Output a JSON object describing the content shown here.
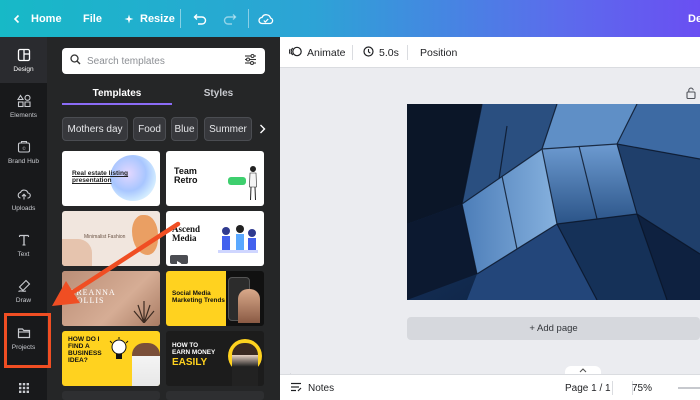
{
  "topbar": {
    "home_label": "Home",
    "file_label": "File",
    "resize_label": "Resize",
    "right_truncated_text": "De"
  },
  "rail": {
    "items": [
      {
        "label": "Design",
        "icon": "layout-icon",
        "active": true
      },
      {
        "label": "Elements",
        "icon": "shapes-icon",
        "active": false
      },
      {
        "label": "Brand Hub",
        "icon": "brand-icon",
        "active": false
      },
      {
        "label": "Uploads",
        "icon": "cloud-upload-icon",
        "active": false
      },
      {
        "label": "Text",
        "icon": "text-icon",
        "active": false
      },
      {
        "label": "Draw",
        "icon": "draw-icon",
        "active": false
      },
      {
        "label": "Projects",
        "icon": "folder-icon",
        "active": false
      }
    ]
  },
  "panel": {
    "search_placeholder": "Search templates",
    "tabs": [
      {
        "label": "Templates",
        "active": true
      },
      {
        "label": "Styles",
        "active": false
      }
    ],
    "chips": [
      "Mothers day",
      "Food",
      "Blue",
      "Summer"
    ],
    "templates": {
      "t1_title": "Real estate listing presentation",
      "t2_title": "Team Retro",
      "t3_title": "Minimalist Fashion",
      "t4_title": "Ascend Media",
      "t5_title": "BREANNA HOLLIS",
      "t6_title": "Social Media Marketing Trends",
      "t7_title": "HOW DO I FIND A BUSINESS IDEA?",
      "t8_title_line1": "HOW TO",
      "t8_title_line2": "EARN MONEY",
      "t8_title_line3": "EASILY"
    }
  },
  "editor": {
    "animate_label": "Animate",
    "duration_label": "5.0s",
    "position_label": "Position",
    "add_page_label": "+ Add page",
    "notes_label": "Notes",
    "page_label": "Page 1 / 1",
    "zoom_label": "75%"
  },
  "colors": {
    "accent_purple": "#8b6cf6",
    "annotation_red": "#f04e23",
    "panel_bg": "#252627",
    "rail_bg": "#18191b"
  }
}
